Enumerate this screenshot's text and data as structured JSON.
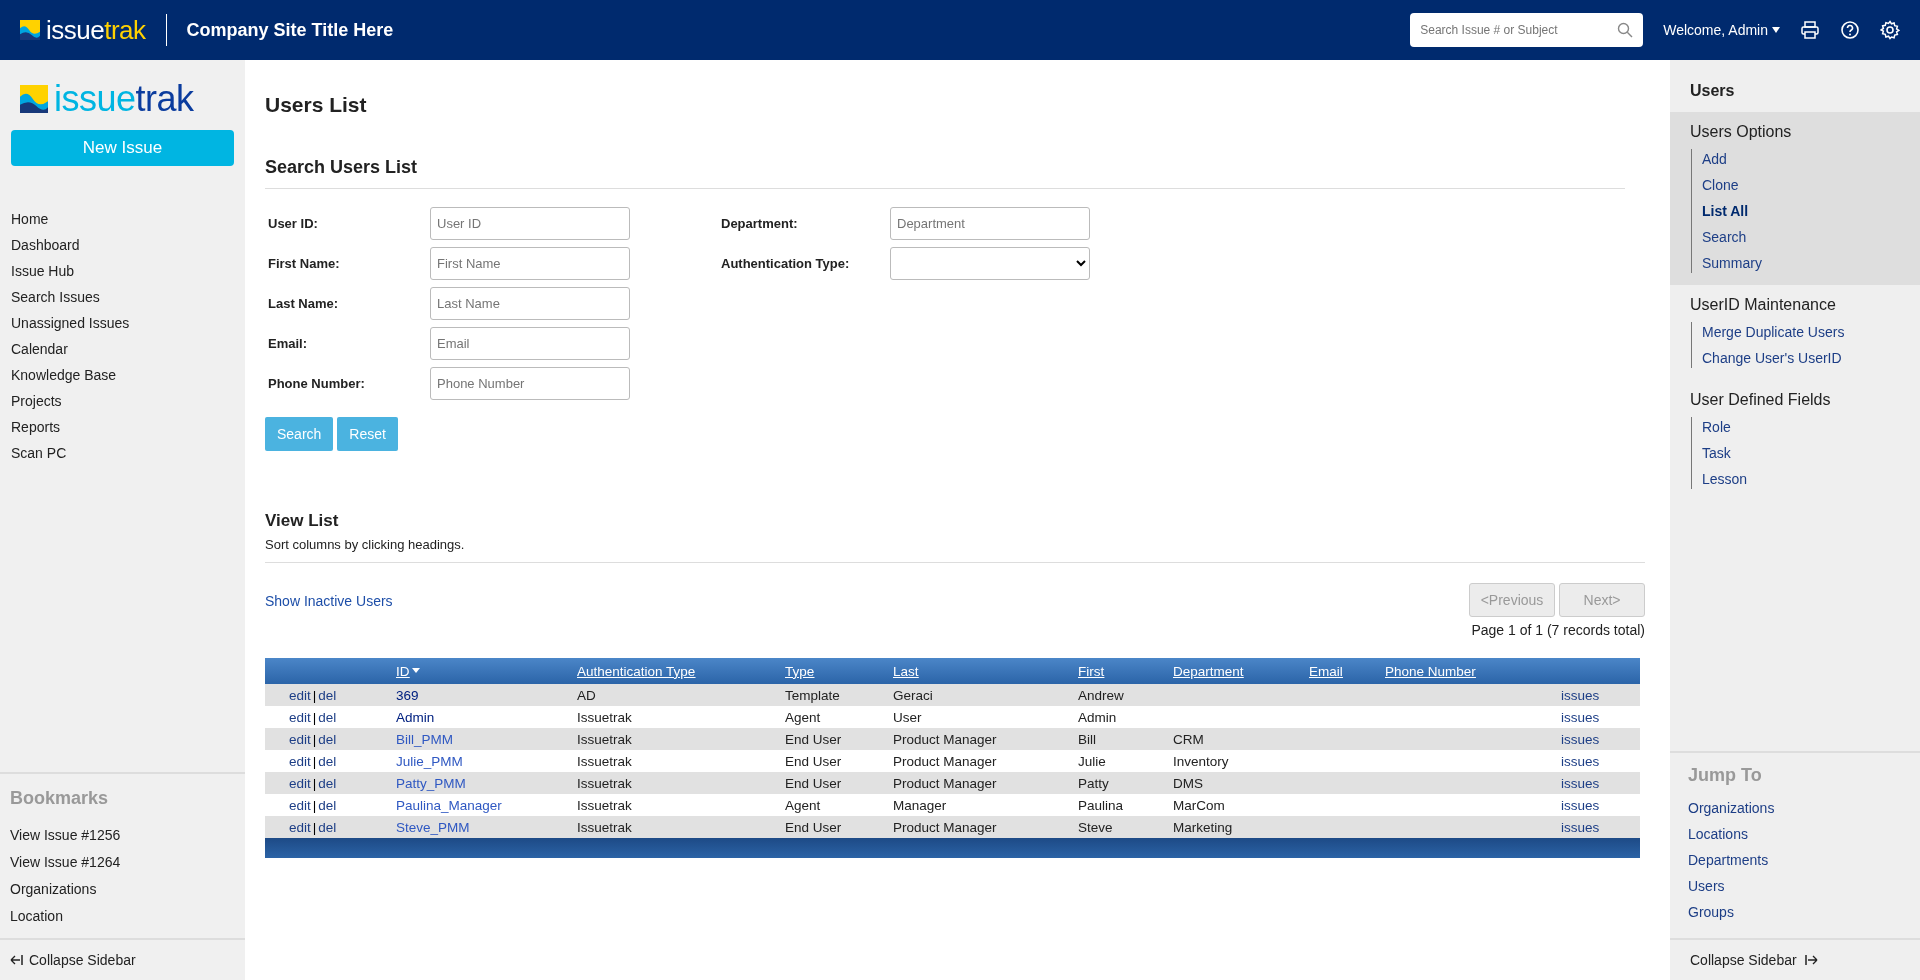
{
  "header": {
    "logo": {
      "parts": [
        "issue",
        "trak"
      ]
    },
    "site_title": "Company Site Title Here",
    "search": {
      "placeholder": "Search Issue # or Subject"
    },
    "user_menu": "Welcome, Admin"
  },
  "left_sidebar": {
    "logo": {
      "parts": [
        "issue",
        "trak"
      ]
    },
    "new_issue_button": "New Issue",
    "nav_items": [
      "Home",
      "Dashboard",
      "Issue Hub",
      "Search Issues",
      "Unassigned Issues",
      "Calendar",
      "Knowledge Base",
      "Projects",
      "Reports",
      "Scan PC"
    ],
    "bookmarks": {
      "title": "Bookmarks",
      "items": [
        "View Issue #1256",
        "View Issue #1264",
        "Organizations",
        "Location"
      ]
    },
    "collapse": "Collapse Sidebar"
  },
  "main": {
    "title": "Users List",
    "search_form": {
      "title": "Search Users List",
      "columns": [
        [
          {
            "label": "User ID:",
            "kind": "text",
            "placeholder": "User ID"
          },
          {
            "label": "First Name:",
            "kind": "text",
            "placeholder": "First Name"
          },
          {
            "label": "Last Name:",
            "kind": "text",
            "placeholder": "Last Name"
          },
          {
            "label": "Email:",
            "kind": "text",
            "placeholder": "Email"
          },
          {
            "label": "Phone Number:",
            "kind": "text",
            "placeholder": "Phone Number"
          }
        ],
        [
          {
            "label": "Department:",
            "kind": "text",
            "placeholder": "Department"
          },
          {
            "label": "Authentication Type:",
            "kind": "select"
          }
        ]
      ],
      "buttons": [
        "Search",
        "Reset"
      ]
    },
    "view_list": {
      "title": "View List",
      "hint": "Sort columns by clicking headings.",
      "show_inactive_link": "Show Inactive Users",
      "pagination": {
        "buttons": [
          {
            "label": "<Previous",
            "disabled": true
          },
          {
            "label": "Next>",
            "disabled": true
          }
        ],
        "summary": "Page 1 of 1 (7 records total)"
      }
    },
    "table": {
      "columns": [
        {
          "label": "ID",
          "sorted": true
        },
        {
          "label": "Authentication Type",
          "sorted": false
        },
        {
          "label": "Type",
          "sorted": false
        },
        {
          "label": "Last",
          "sorted": false
        },
        {
          "label": "First",
          "sorted": false
        },
        {
          "label": "Department",
          "sorted": false
        },
        {
          "label": "Email",
          "sorted": false
        },
        {
          "label": "Phone Number",
          "sorted": false
        }
      ],
      "rows": [
        {
          "edit_link": "edit",
          "separator": "|",
          "delete_link": "del",
          "id": "369",
          "visited": true,
          "auth_type": "AD",
          "type": "Template",
          "last": "Geraci",
          "first": "Andrew",
          "issues_link": "issues"
        },
        {
          "edit_link": "edit",
          "separator": "|",
          "delete_link": "del",
          "id": "Admin",
          "visited": true,
          "auth_type": "Issuetrak",
          "type": "Agent",
          "last": "User",
          "first": "Admin",
          "issues_link": "issues"
        },
        {
          "edit_link": "edit",
          "separator": "|",
          "delete_link": "del",
          "id": "Bill_PMM",
          "visited": false,
          "auth_type": "Issuetrak",
          "type": "End User",
          "last": "Product Manager",
          "first": "Bill",
          "department": "CRM",
          "issues_link": "issues"
        },
        {
          "edit_link": "edit",
          "separator": "|",
          "delete_link": "del",
          "id": "Julie_PMM",
          "visited": false,
          "auth_type": "Issuetrak",
          "type": "End User",
          "last": "Product Manager",
          "first": "Julie",
          "department": "Inventory",
          "issues_link": "issues"
        },
        {
          "edit_link": "edit",
          "separator": "|",
          "delete_link": "del",
          "id": "Patty_PMM",
          "visited": false,
          "auth_type": "Issuetrak",
          "type": "End User",
          "last": "Product Manager",
          "first": "Patty",
          "department": "DMS",
          "issues_link": "issues"
        },
        {
          "edit_link": "edit",
          "separator": "|",
          "delete_link": "del",
          "id": "Paulina_Manager",
          "visited": false,
          "auth_type": "Issuetrak",
          "type": "Agent",
          "last": "Manager",
          "first": "Paulina",
          "department": "MarCom",
          "issues_link": "issues"
        },
        {
          "edit_link": "edit",
          "separator": "|",
          "delete_link": "del",
          "id": "Steve_PMM",
          "visited": false,
          "auth_type": "Issuetrak",
          "type": "End User",
          "last": "Product Manager",
          "first": "Steve",
          "department": "Marketing",
          "issues_link": "issues"
        }
      ]
    }
  },
  "right_sidebar": {
    "title": "Users",
    "sections": [
      {
        "title": "Users Options",
        "active": true,
        "items": [
          {
            "label": "Add",
            "selected": false
          },
          {
            "label": "Clone",
            "selected": false
          },
          {
            "label": "List All",
            "selected": true
          },
          {
            "label": "Search",
            "selected": false
          },
          {
            "label": "Summary",
            "selected": false
          }
        ]
      },
      {
        "title": "UserID Maintenance",
        "active": false,
        "items": [
          {
            "label": "Merge Duplicate Users",
            "selected": false
          },
          {
            "label": "Change User's UserID",
            "selected": false
          }
        ]
      },
      {
        "title": "User Defined Fields",
        "active": false,
        "items": [
          {
            "label": "Role",
            "selected": false
          },
          {
            "label": "Task",
            "selected": false
          },
          {
            "label": "Lesson",
            "selected": false
          }
        ]
      }
    ],
    "jump_to": {
      "title": "Jump To",
      "items": [
        "Organizations",
        "Locations",
        "Departments",
        "Users",
        "Groups"
      ]
    },
    "collapse": "Collapse Sidebar"
  }
}
